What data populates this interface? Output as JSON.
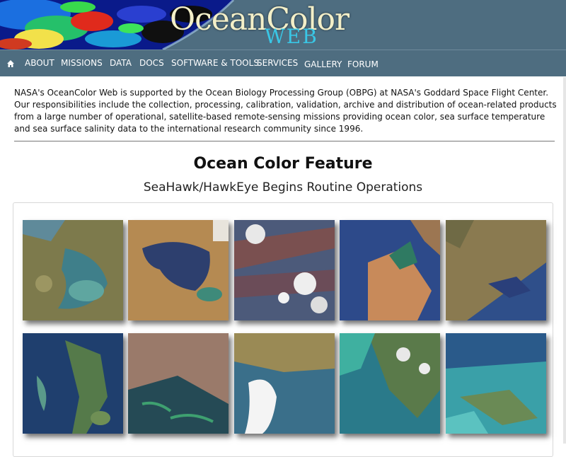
{
  "banner": {
    "title": "OceanColor",
    "subtitle": "WEB"
  },
  "nav": {
    "home_icon": "home-icon",
    "items": [
      "ABOUT",
      "MISSIONS",
      "DATA",
      "DOCS",
      "SOFTWARE & TOOLS",
      "SERVICES",
      "GALLERY",
      "FORUM"
    ]
  },
  "intro": {
    "text": "NASA's OceanColor Web is supported by the Ocean Biology Processing Group (OBPG) at NASA's Goddard Space Flight Center. Our responsibilities include the collection, processing, calibration, validation, archive and distribution of ocean-related products from a large number of operational, satellite-based remote-sensing missions providing ocean color, sea surface temperature and sea surface salinity data to the international research community since 1996."
  },
  "feature": {
    "title": "Ocean Color Feature",
    "subtitle": "SeaHawk/HawkEye Begins Routine Operations"
  },
  "colors": {
    "nav_background": "#4e6d80",
    "banner_title": "#f3efc8",
    "banner_subtitle": "#39c7e6"
  }
}
